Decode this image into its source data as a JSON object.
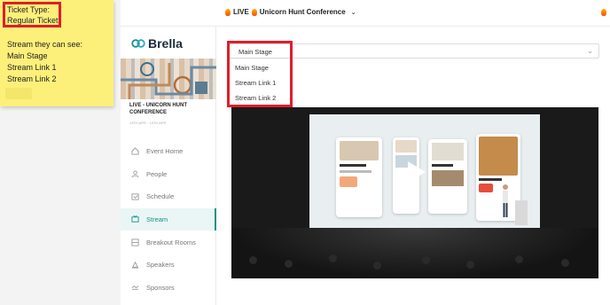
{
  "sticky_note": {
    "ticket_type_label": "Ticket Type:",
    "ticket_type_value": "Regular Ticket",
    "streams_heading": "Stream they can see:",
    "streams": [
      "Main Stage",
      "Stream Link 1",
      "Stream Link 2"
    ]
  },
  "topbar": {
    "live_label": "LIVE",
    "event_title": "Unicorn Hunt Conference"
  },
  "sidebar": {
    "brand": "Brella",
    "event_name": "LIVE - UNICORN HUNT CONFERENCE",
    "event_dates": "13TH APR - 14TH APR",
    "nav": [
      {
        "label": "Event Home",
        "icon": "home-icon"
      },
      {
        "label": "People",
        "icon": "people-icon"
      },
      {
        "label": "Schedule",
        "icon": "calendar-icon"
      },
      {
        "label": "Stream",
        "icon": "tv-icon"
      },
      {
        "label": "Breakout Rooms",
        "icon": "rooms-icon"
      },
      {
        "label": "Speakers",
        "icon": "speaker-icon"
      },
      {
        "label": "Sponsors",
        "icon": "handshake-icon"
      }
    ],
    "active_item": "Stream"
  },
  "stream_select": {
    "value": "Main Stage",
    "options": [
      "Main Stage",
      "Stream Link 1",
      "Stream Link 2"
    ]
  },
  "colors": {
    "accent": "#1e8f8a",
    "highlight_red": "#e01e2b",
    "note_yellow": "#fdf07a"
  }
}
